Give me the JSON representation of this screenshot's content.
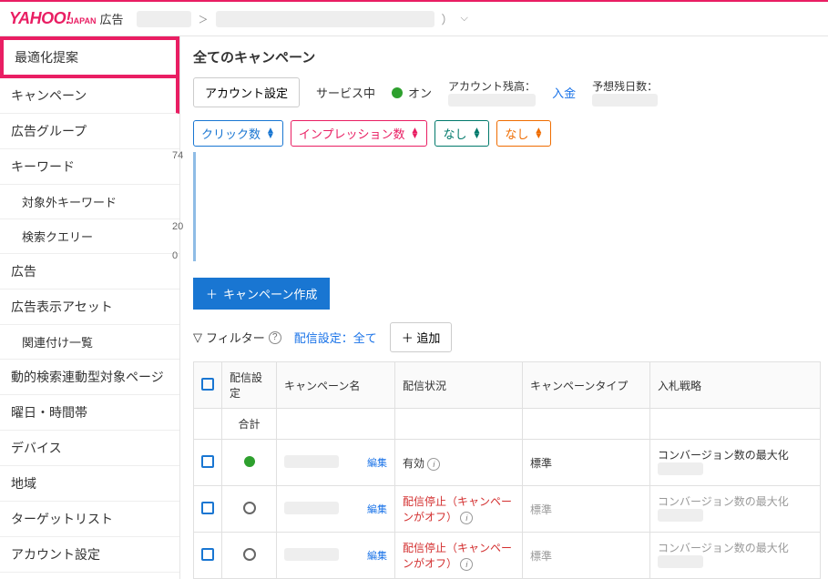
{
  "logo": {
    "yahoo": "YAHOO!",
    "japan": "JAPAN",
    "ad": "広告"
  },
  "breadcrumb": {
    "sep": "＞",
    "paren": "）"
  },
  "sidebar": {
    "items": [
      {
        "label": "最適化提案",
        "highlight": true
      },
      {
        "label": "キャンペーン",
        "active": true
      },
      {
        "label": "広告グループ"
      },
      {
        "label": "キーワード"
      },
      {
        "label": "対象外キーワード",
        "sub": true
      },
      {
        "label": "検索クエリー",
        "sub": true
      },
      {
        "label": "広告"
      },
      {
        "label": "広告表示アセット"
      },
      {
        "label": "関連付け一覧",
        "sub": true
      },
      {
        "label": "動的検索連動型対象ページ"
      },
      {
        "label": "曜日・時間帯"
      },
      {
        "label": "デバイス"
      },
      {
        "label": "地域"
      },
      {
        "label": "ターゲットリスト"
      },
      {
        "label": "アカウント設定"
      }
    ]
  },
  "main": {
    "title": "全てのキャンペーン",
    "account_settings_btn": "アカウント設定",
    "service_label": "サービス中",
    "on_label": "オン",
    "balance_label": "アカウント残高：",
    "deposit_link": "入金",
    "days_label": "予想残日数：",
    "metrics": [
      {
        "label": "クリック数",
        "cls": "ms-blue"
      },
      {
        "label": "インプレッション数",
        "cls": "ms-pink"
      },
      {
        "label": "なし",
        "cls": "ms-teal"
      },
      {
        "label": "なし",
        "cls": "ms-orange"
      }
    ],
    "create_btn": "キャンペーン作成",
    "filter_label": "フィルター",
    "dist_filter": "配信設定：全て",
    "add_btn": "追加",
    "columns": {
      "dist_setting": "配信設定",
      "camp_name": "キャンペーン名",
      "dist_status": "配信状況",
      "camp_type": "キャンペーンタイプ",
      "bid_strategy": "入札戦略"
    },
    "total_row": "合計",
    "edit": "編集",
    "rows": [
      {
        "status": "green",
        "dist_status": "有効",
        "dist_red": false,
        "type": "標準",
        "type_grey": false,
        "bid": "コンバージョン数の最大化"
      },
      {
        "status": "empty",
        "dist_status": "配信停止（キャンペーンがオフ）",
        "dist_red": true,
        "type": "標準",
        "type_grey": true,
        "bid": "コンバージョン数の最大化"
      },
      {
        "status": "empty",
        "dist_status": "配信停止（キャンペーンがオフ）",
        "dist_red": true,
        "type": "標準",
        "type_grey": true,
        "bid": "コンバージョン数の最大化"
      }
    ]
  },
  "chart_data": {
    "type": "line",
    "title": "",
    "xlabel": "",
    "ylabel": "",
    "ylim": [
      0,
      74
    ],
    "ticks": [
      74,
      20,
      0
    ],
    "series": []
  }
}
